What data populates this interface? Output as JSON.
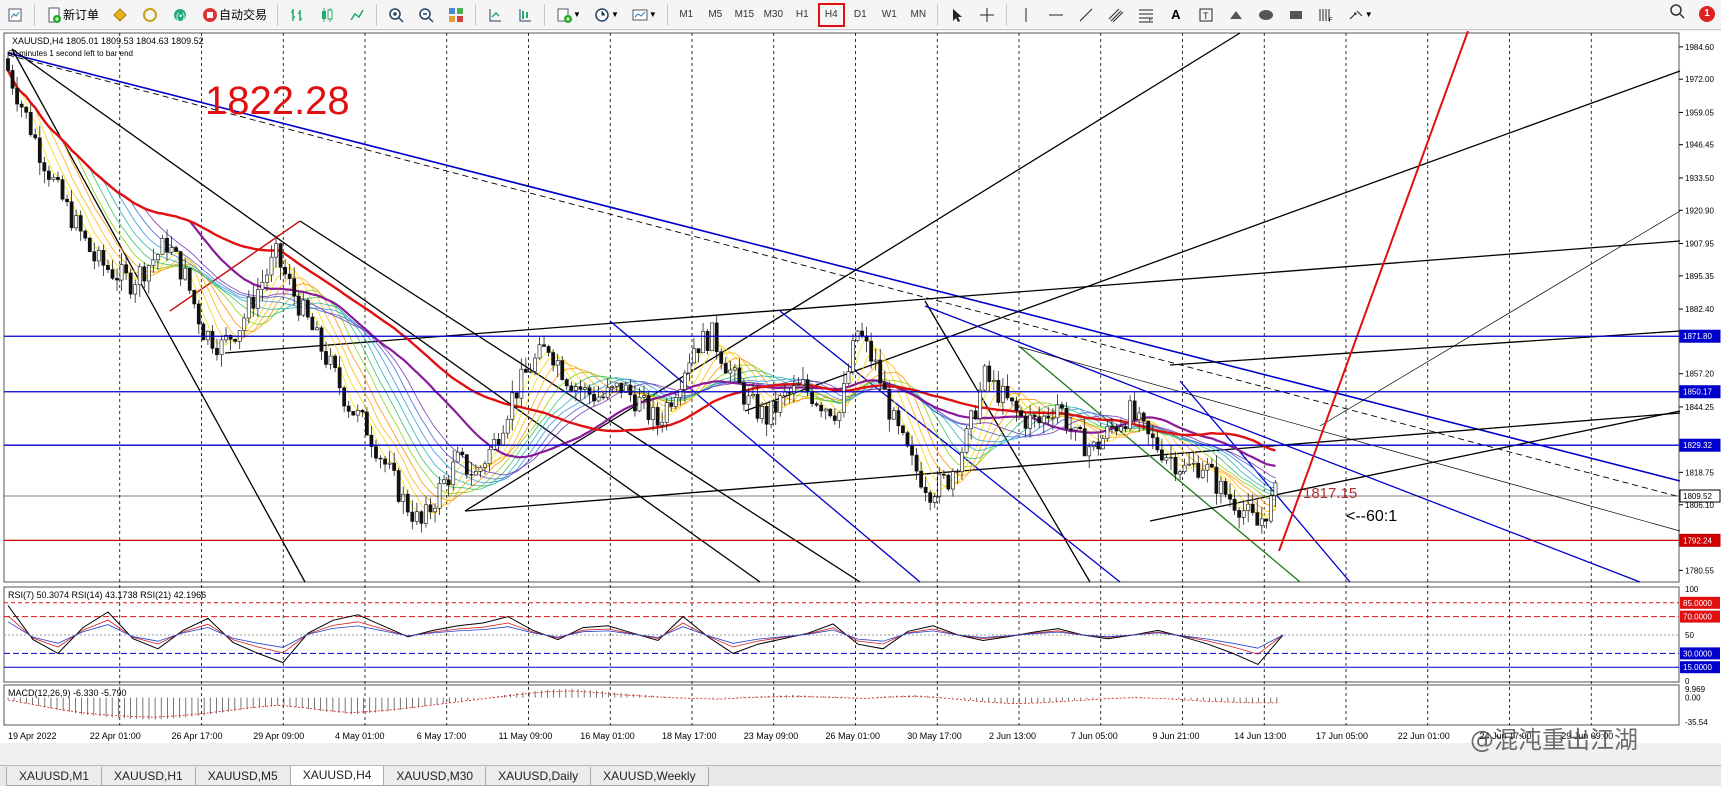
{
  "toolbar": {
    "new_order": "新订单",
    "auto_trade": "自动交易",
    "timeframes": [
      "M1",
      "M5",
      "M15",
      "M30",
      "H1",
      "H4",
      "D1",
      "W1",
      "MN"
    ],
    "active_timeframe": "H4",
    "notification_count": "1"
  },
  "chart_info": {
    "symbol_line": "XAUUSD,H4  1805.01 1809.53 1804.63 1809.52",
    "countdown": "60 minutes 1 second left to bar end"
  },
  "annotations": {
    "big_price": "1822.28",
    "small_price": "1817.15",
    "ratio": "<--60:1"
  },
  "rsi_panel": {
    "label": "RSI(7) 50.3074  RSI(14) 43.1738  RSI(21) 42.1966",
    "levels": [
      "85.0000",
      "70.0000",
      "30.0000",
      "15.0000"
    ],
    "scale": [
      "100",
      "50",
      "0"
    ]
  },
  "macd_panel": {
    "label": "MACD(12,26,9) -6.330 -5.790",
    "scale": [
      "9.969",
      "0.00",
      "-35.54"
    ]
  },
  "chart_data": {
    "type": "candlestick",
    "symbol": "XAUUSD",
    "timeframe": "H4",
    "ohlc_last": {
      "open": 1805.01,
      "high": 1809.53,
      "low": 1804.63,
      "close": 1809.52
    },
    "y_ticks": [
      "1984.60",
      "1972.00",
      "1959.05",
      "1946.45",
      "1933.50",
      "1920.90",
      "1907.95",
      "1895.35",
      "1882.40",
      "1857.20",
      "1844.25",
      "1818.75",
      "1806.10",
      "1780.55"
    ],
    "y_range": [
      1776,
      1990
    ],
    "x_ticks": [
      "19 Apr 2022",
      "22 Apr 01:00",
      "26 Apr 17:00",
      "29 Apr 09:00",
      "4 May 01:00",
      "6 May 17:00",
      "11 May 09:00",
      "16 May 01:00",
      "18 May 17:00",
      "23 May 09:00",
      "26 May 01:00",
      "30 May 17:00",
      "2 Jun 13:00",
      "7 Jun 05:00",
      "9 Jun 21:00",
      "14 Jun 13:00",
      "17 Jun 05:00",
      "22 Jun 01:00",
      "24 Jun 17:00",
      "29 Jun 09:00"
    ],
    "horizontal_levels": [
      {
        "value": "1871.80",
        "color": "#0000cc"
      },
      {
        "value": "1850.17",
        "color": "#0000cc"
      },
      {
        "value": "1829.32",
        "color": "#0000cc"
      },
      {
        "value": "1809.52",
        "color": "#000000"
      },
      {
        "value": "1792.24",
        "color": "#cc0000"
      }
    ],
    "price_path": [
      1980,
      1962,
      1944,
      1928,
      1915,
      1902,
      1897,
      1893,
      1900,
      1908,
      1895,
      1874,
      1868,
      1876,
      1890,
      1903,
      1888,
      1874,
      1860,
      1845,
      1836,
      1822,
      1808,
      1798,
      1812,
      1823,
      1818,
      1830,
      1848,
      1860,
      1868,
      1856,
      1850,
      1848,
      1852,
      1846,
      1838,
      1852,
      1868,
      1872,
      1858,
      1846,
      1840,
      1848,
      1852,
      1846,
      1842,
      1874,
      1860,
      1838,
      1822,
      1812,
      1816,
      1832,
      1856,
      1848,
      1840,
      1838,
      1846,
      1832,
      1828,
      1836,
      1842,
      1832,
      1826,
      1820,
      1822,
      1812,
      1806,
      1798,
      1810
    ],
    "rsi7": [
      82,
      45,
      30,
      58,
      75,
      46,
      35,
      55,
      68,
      42,
      30,
      20,
      52,
      66,
      72,
      60,
      48,
      55,
      60,
      63,
      70,
      55,
      45,
      58,
      60,
      52,
      44,
      70,
      48,
      30,
      40,
      46,
      52,
      62,
      40,
      35,
      54,
      60,
      50,
      44,
      48,
      53,
      57,
      50,
      46,
      50,
      55,
      48,
      40,
      30,
      18,
      50
    ],
    "macd_hist": [
      -2,
      -8,
      -14,
      -19,
      -22,
      -24,
      -25,
      -23,
      -20,
      -16,
      -12,
      -9,
      -12,
      -16,
      -19,
      -17,
      -14,
      -10,
      -6,
      -2,
      2,
      6,
      9,
      10,
      8,
      5,
      3,
      1,
      0,
      -1,
      1,
      2,
      3,
      2,
      1,
      0,
      2,
      3,
      1,
      -2,
      -5,
      -7,
      -6,
      -4,
      -2,
      0,
      1,
      0,
      -2,
      -4,
      -5,
      -6
    ]
  },
  "tabs": [
    "XAUUSD,M1",
    "XAUUSD,H1",
    "XAUUSD,M5",
    "XAUUSD,H4",
    "XAUUSD,M30",
    "XAUUSD,Daily",
    "XAUUSD,Weekly"
  ],
  "active_tab": "XAUUSD,H4",
  "watermark": "@混沌重出江湖"
}
